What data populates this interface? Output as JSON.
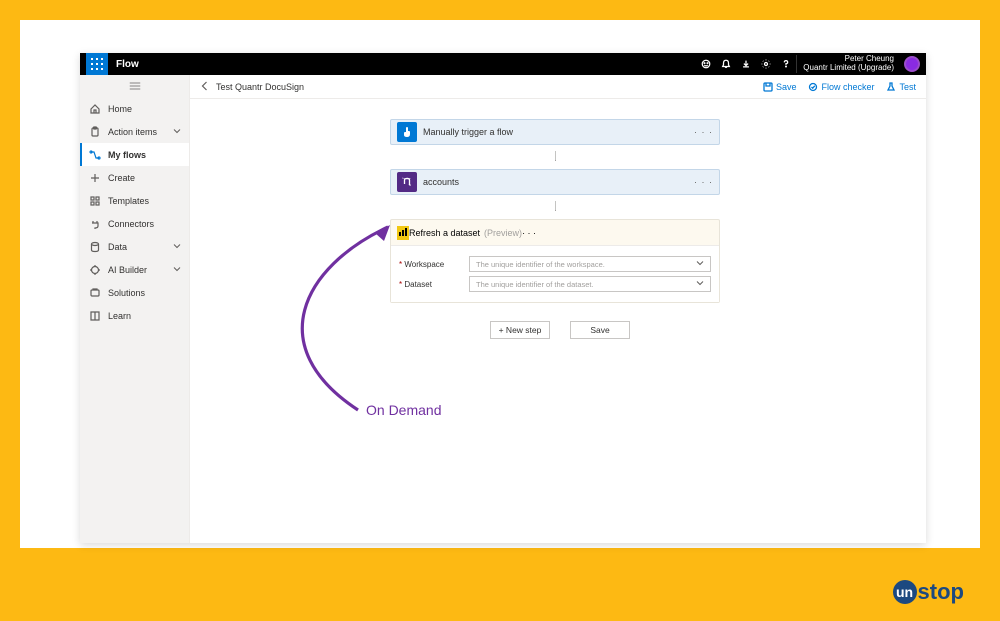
{
  "topbar": {
    "brand": "Flow",
    "user_name": "Peter Cheung",
    "tenant": "Quantr Limited (Upgrade)"
  },
  "sidebar": {
    "items": [
      {
        "label": "Home"
      },
      {
        "label": "Action items"
      },
      {
        "label": "My flows"
      },
      {
        "label": "Create"
      },
      {
        "label": "Templates"
      },
      {
        "label": "Connectors"
      },
      {
        "label": "Data"
      },
      {
        "label": "AI Builder"
      },
      {
        "label": "Solutions"
      },
      {
        "label": "Learn"
      }
    ]
  },
  "commandbar": {
    "title": "Test Quantr DocuSign",
    "save": "Save",
    "flow_checker": "Flow checker",
    "test": "Test"
  },
  "steps": {
    "trigger": {
      "title": "Manually trigger a flow"
    },
    "accounts": {
      "title": "accounts"
    },
    "refresh": {
      "title": "Refresh a dataset",
      "preview": "(Preview)",
      "fields": {
        "workspace": {
          "label": "Workspace",
          "placeholder": "The unique identifier of the workspace."
        },
        "dataset": {
          "label": "Dataset",
          "placeholder": "The unique identifier of the dataset."
        }
      }
    }
  },
  "actions": {
    "new_step": "+ New step",
    "save": "Save"
  },
  "annotation": {
    "text": "On Demand"
  },
  "footer_logo": {
    "text_rest": "stop",
    "text_un": "un"
  }
}
